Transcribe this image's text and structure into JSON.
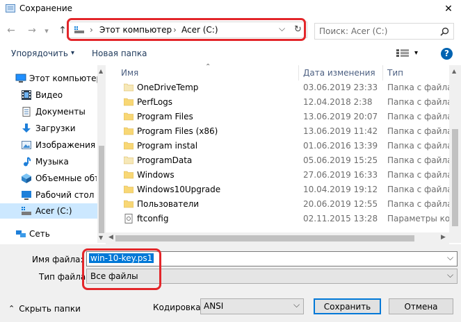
{
  "window": {
    "title": "Сохранение",
    "close_glyph": "✕"
  },
  "nav": {
    "back": "←",
    "forward": "→",
    "recent": "▾",
    "up": "↑"
  },
  "address": {
    "sep1": "›",
    "crumb1": "Этот компьютер",
    "sep2": "›",
    "crumb2": "Acer (C:)",
    "dropdown": "⌵",
    "refresh": "↻"
  },
  "search": {
    "placeholder": "Поиск: Acer (C:)"
  },
  "toolbar": {
    "organize": "Упорядочить",
    "organize_arrow": "▾",
    "new_folder": "Новая папка",
    "view_arrow": "▾",
    "help": "?"
  },
  "sidebar": {
    "items": [
      {
        "label": "Этот компьютер",
        "icon": "computer-icon"
      },
      {
        "label": "Видео",
        "icon": "video-icon"
      },
      {
        "label": "Документы",
        "icon": "documents-icon"
      },
      {
        "label": "Загрузки",
        "icon": "downloads-icon"
      },
      {
        "label": "Изображения",
        "icon": "images-icon"
      },
      {
        "label": "Музыка",
        "icon": "music-icon"
      },
      {
        "label": "Объемные объ",
        "icon": "3d-objects-icon"
      },
      {
        "label": "Рабочий стол",
        "icon": "desktop-icon"
      },
      {
        "label": "Acer (C:)",
        "icon": "drive-icon"
      },
      {
        "label": "Сеть",
        "icon": "network-icon"
      }
    ]
  },
  "columns": {
    "name": "Имя",
    "date": "Дата изменения",
    "type": "Тип"
  },
  "files": [
    {
      "name": "OneDriveTemp",
      "date": "03.06.2019 23:33",
      "type": "Папка с файлами",
      "icon": "folder-icon"
    },
    {
      "name": "PerfLogs",
      "date": "12.04.2018 2:38",
      "type": "Папка с файлами",
      "icon": "folder-icon"
    },
    {
      "name": "Program Files",
      "date": "13.06.2019 20:07",
      "type": "Папка с файлами",
      "icon": "folder-icon"
    },
    {
      "name": "Program Files (x86)",
      "date": "13.06.2019 11:42",
      "type": "Папка с файлами",
      "icon": "folder-icon"
    },
    {
      "name": "Program instal",
      "date": "01.06.2016 13:39",
      "type": "Папка с файлами",
      "icon": "folder-icon"
    },
    {
      "name": "ProgramData",
      "date": "05.06.2019 15:25",
      "type": "Папка с файлами",
      "icon": "folder-icon"
    },
    {
      "name": "Windows",
      "date": "27.06.2019 16:33",
      "type": "Папка с файлами",
      "icon": "folder-icon"
    },
    {
      "name": "Windows10Upgrade",
      "date": "10.04.2019 19:12",
      "type": "Папка с файлами",
      "icon": "folder-icon"
    },
    {
      "name": "Пользователи",
      "date": "20.06.2019 12:55",
      "type": "Папка с файлами",
      "icon": "folder-icon"
    },
    {
      "name": "ftconfig",
      "date": "02.11.2015 13:28",
      "type": "Параметры конф",
      "icon": "config-file-icon"
    }
  ],
  "form": {
    "filename_label": "Имя файла:",
    "filename_value": "win-10-key.ps1",
    "filetype_label": "Тип файла:",
    "filetype_value": "Все файлы",
    "dropdown_glyph": "⌵"
  },
  "footer": {
    "hide_folders": "Скрыть папки",
    "hide_arrow": "⌃",
    "encoding_label": "Кодировка:",
    "encoding_value": "ANSI",
    "save": "Сохранить",
    "cancel": "Отмена"
  },
  "colors": {
    "accent": "#0078d7",
    "highlight": "#e3262a",
    "folder": "#f8d775"
  }
}
